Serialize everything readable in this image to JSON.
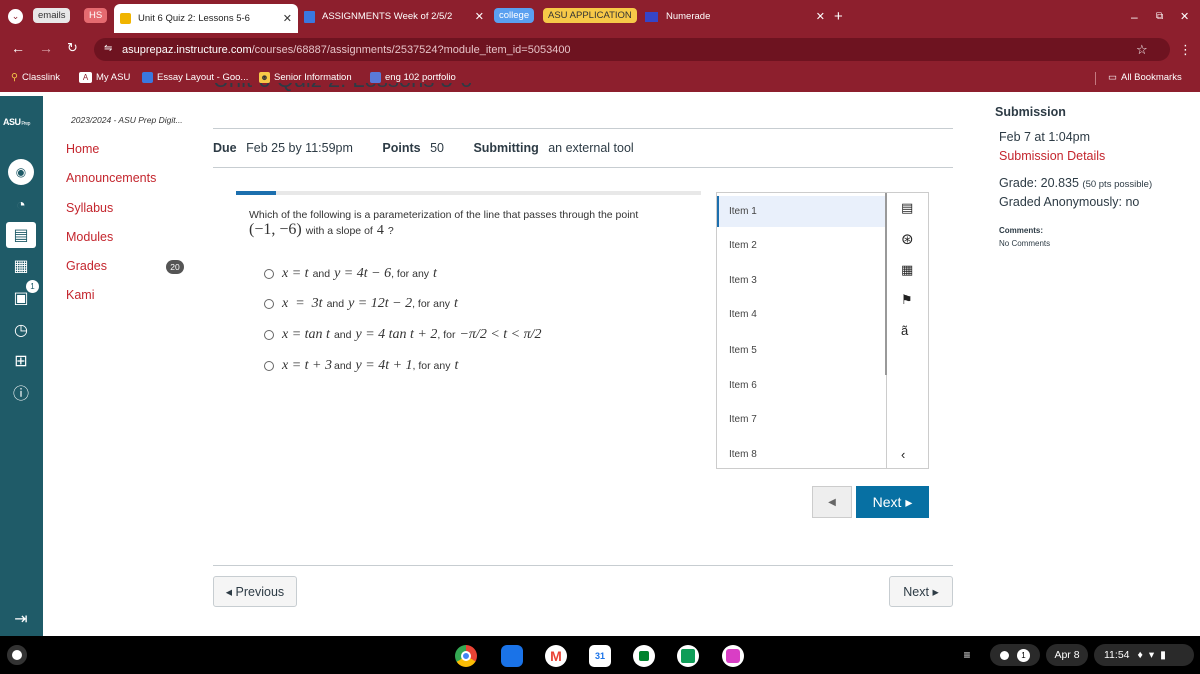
{
  "tabs": {
    "emails": "emails",
    "hs": "HS",
    "active": "Unit 6 Quiz 2: Lessons 5-6",
    "assignments": "ASSIGNMENTS Week of 2/5/2",
    "college": "college",
    "asu_app": "ASU APPLICATION",
    "numerade": "Numerade",
    "new_tab": "+"
  },
  "address_bar": {
    "domain": "asuprepaz.instructure.com",
    "path": "/courses/68887/assignments/2537524?module_item_id=5053400"
  },
  "bookmarks": [
    "Classlink",
    "My ASU",
    "Essay Layout - Goo...",
    "Senior Information",
    "eng 102 portfolio"
  ],
  "all_bookmarks": "All Bookmarks",
  "course": {
    "title_partial": "Unit 6 Quiz 2: Lessons 5-6",
    "term": "2023/2024 - ASU Prep Digit...",
    "nav": [
      "Home",
      "Announcements",
      "Syllabus",
      "Modules",
      "Grades",
      "Kami"
    ],
    "grades_badge": "20",
    "inbox_badge": "1"
  },
  "assignment": {
    "due_label": "Due",
    "due_value": "Feb 25 by 11:59pm",
    "points_label": "Points",
    "points_value": "50",
    "submitting_label": "Submitting",
    "submitting_value": "an external tool"
  },
  "question": {
    "text": "Which of the following is a parameterization of the line that passes through the point",
    "point": "(−1, −6)",
    "slope_text": "with a slope of",
    "slope_value": "4",
    "options": [
      {
        "x": "x = t",
        "and": "and",
        "y": "y = 4t − 6",
        "cond": ", for any",
        "var": "t"
      },
      {
        "x": "x  =  3t",
        "and": "and",
        "y": "y = 12t − 2",
        "cond": ", for any",
        "var": "t"
      },
      {
        "x": "x = tan t",
        "and": "and",
        "y": "y = 4 tan t + 2",
        "cond": ", for",
        "var": "−π/2 < t < π/2"
      },
      {
        "x": "x = t + 3",
        "and": "and",
        "y": "y = 4t + 1",
        "cond": ", for any",
        "var": "t"
      }
    ]
  },
  "items": [
    "Item 1",
    "Item 2",
    "Item 3",
    "Item 4",
    "Item 5",
    "Item 6",
    "Item 7",
    "Item 8"
  ],
  "quiz_nav": {
    "next": "Next ▸",
    "prev_arrow": "◀"
  },
  "page_nav": {
    "previous": "◂ Previous",
    "next": "Next ▸"
  },
  "submission": {
    "heading": "Submission",
    "date": "Feb 7 at 1:04pm",
    "details_link": "Submission Details",
    "grade_label": "Grade: 20.835",
    "grade_possible": "(50 pts possible)",
    "graded_anon": "Graded Anonymously: no",
    "comments_label": "Comments:",
    "comments_value": "No Comments"
  },
  "shelf": {
    "date": "Apr 8",
    "time": "11:54",
    "notif_count": "1"
  },
  "colors": {
    "chrome_frame": "#8d1f2d",
    "canvas_nav": "#1f5b68",
    "link_red": "#c4262e",
    "next_button": "#0770a3"
  }
}
